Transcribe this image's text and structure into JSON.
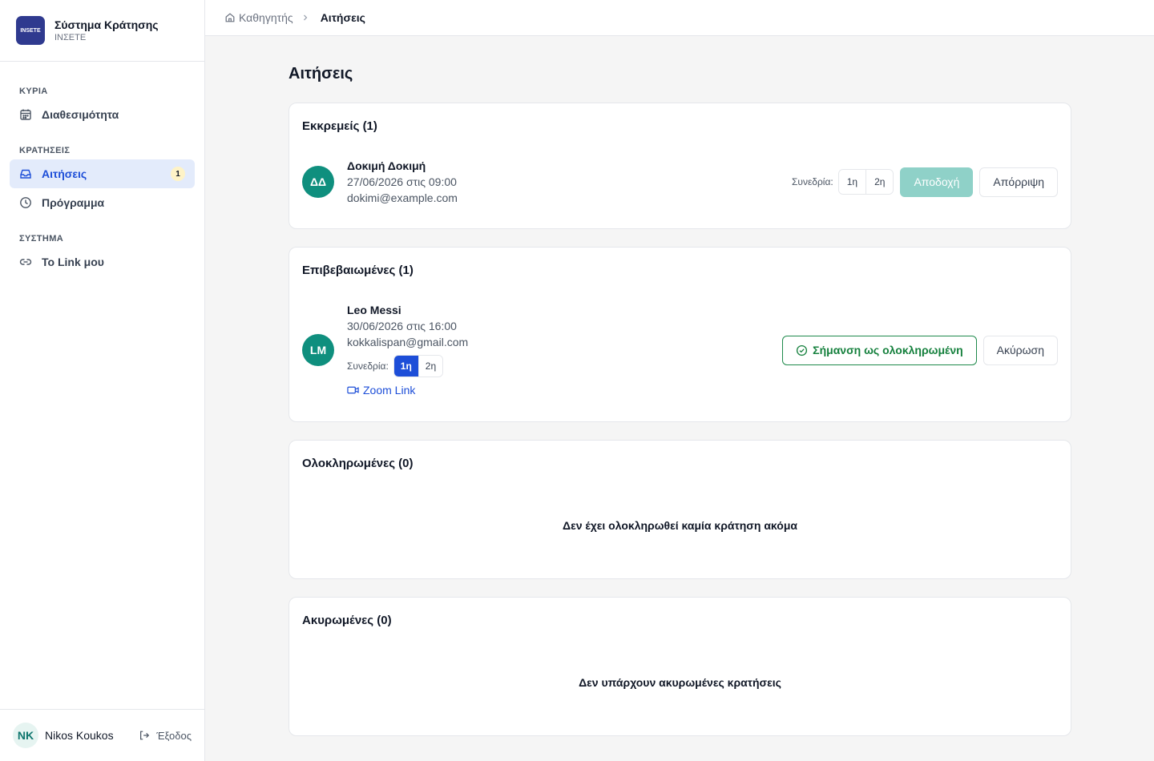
{
  "brand": {
    "logo_text": "INSETE",
    "title": "Σύστημα Κράτησης",
    "subtitle": "ΙΝΣΕΤΕ"
  },
  "nav": {
    "section_main": "ΚΥΡΙΑ",
    "availability": "Διαθεσιμότητα",
    "section_bookings": "ΚΡΑΤΗΣΕΙΣ",
    "requests": "Αιτήσεις",
    "requests_badge": "1",
    "schedule": "Πρόγραμμα",
    "section_system": "ΣΥΣΤΗΜΑ",
    "my_link": "To Link μου"
  },
  "footer": {
    "user_initials": "NK",
    "user_name": "Nikos Koukos",
    "logout": "Έξοδος"
  },
  "breadcrumb": {
    "home": "Καθηγητής",
    "current": "Αιτήσεις"
  },
  "page": {
    "title": "Αιτήσεις"
  },
  "pending": {
    "title": "Εκκρεμείς (1)",
    "item": {
      "initials": "ΔΔ",
      "name": "Δοκιμή Δοκιμή",
      "datetime": "27/06/2026 στις 09:00",
      "email": "dokimi@example.com",
      "session_label": "Συνεδρία:",
      "session_1": "1η",
      "session_2": "2η",
      "accept": "Αποδοχή",
      "reject": "Απόρριψη"
    }
  },
  "confirmed": {
    "title": "Επιβεβαιωμένες (1)",
    "item": {
      "initials": "LM",
      "name": "Leo Messi",
      "datetime": "30/06/2026 στις 16:00",
      "email": "kokkalispan@gmail.com",
      "session_label": "Συνεδρία:",
      "session_1": "1η",
      "session_2": "2η",
      "selected_session": "1η",
      "zoom_link": "Zoom Link",
      "mark_complete": "Σήμανση ως ολοκληρωμένη",
      "cancel": "Ακύρωση"
    }
  },
  "completed": {
    "title": "Ολοκληρωμένες (0)",
    "empty": "Δεν έχει ολοκληρωθεί καμία κράτηση ακόμα"
  },
  "cancelled": {
    "title": "Ακυρωμένες (0)",
    "empty": "Δεν υπάρχουν ακυρωμένες κρατήσεις"
  },
  "colors": {
    "primary": "#1d4ed8",
    "teal_avatar": "#0f8f7e",
    "accept_button": "#8fd1c8",
    "complete_green": "#15803d",
    "badge_bg": "#fef3c7"
  }
}
